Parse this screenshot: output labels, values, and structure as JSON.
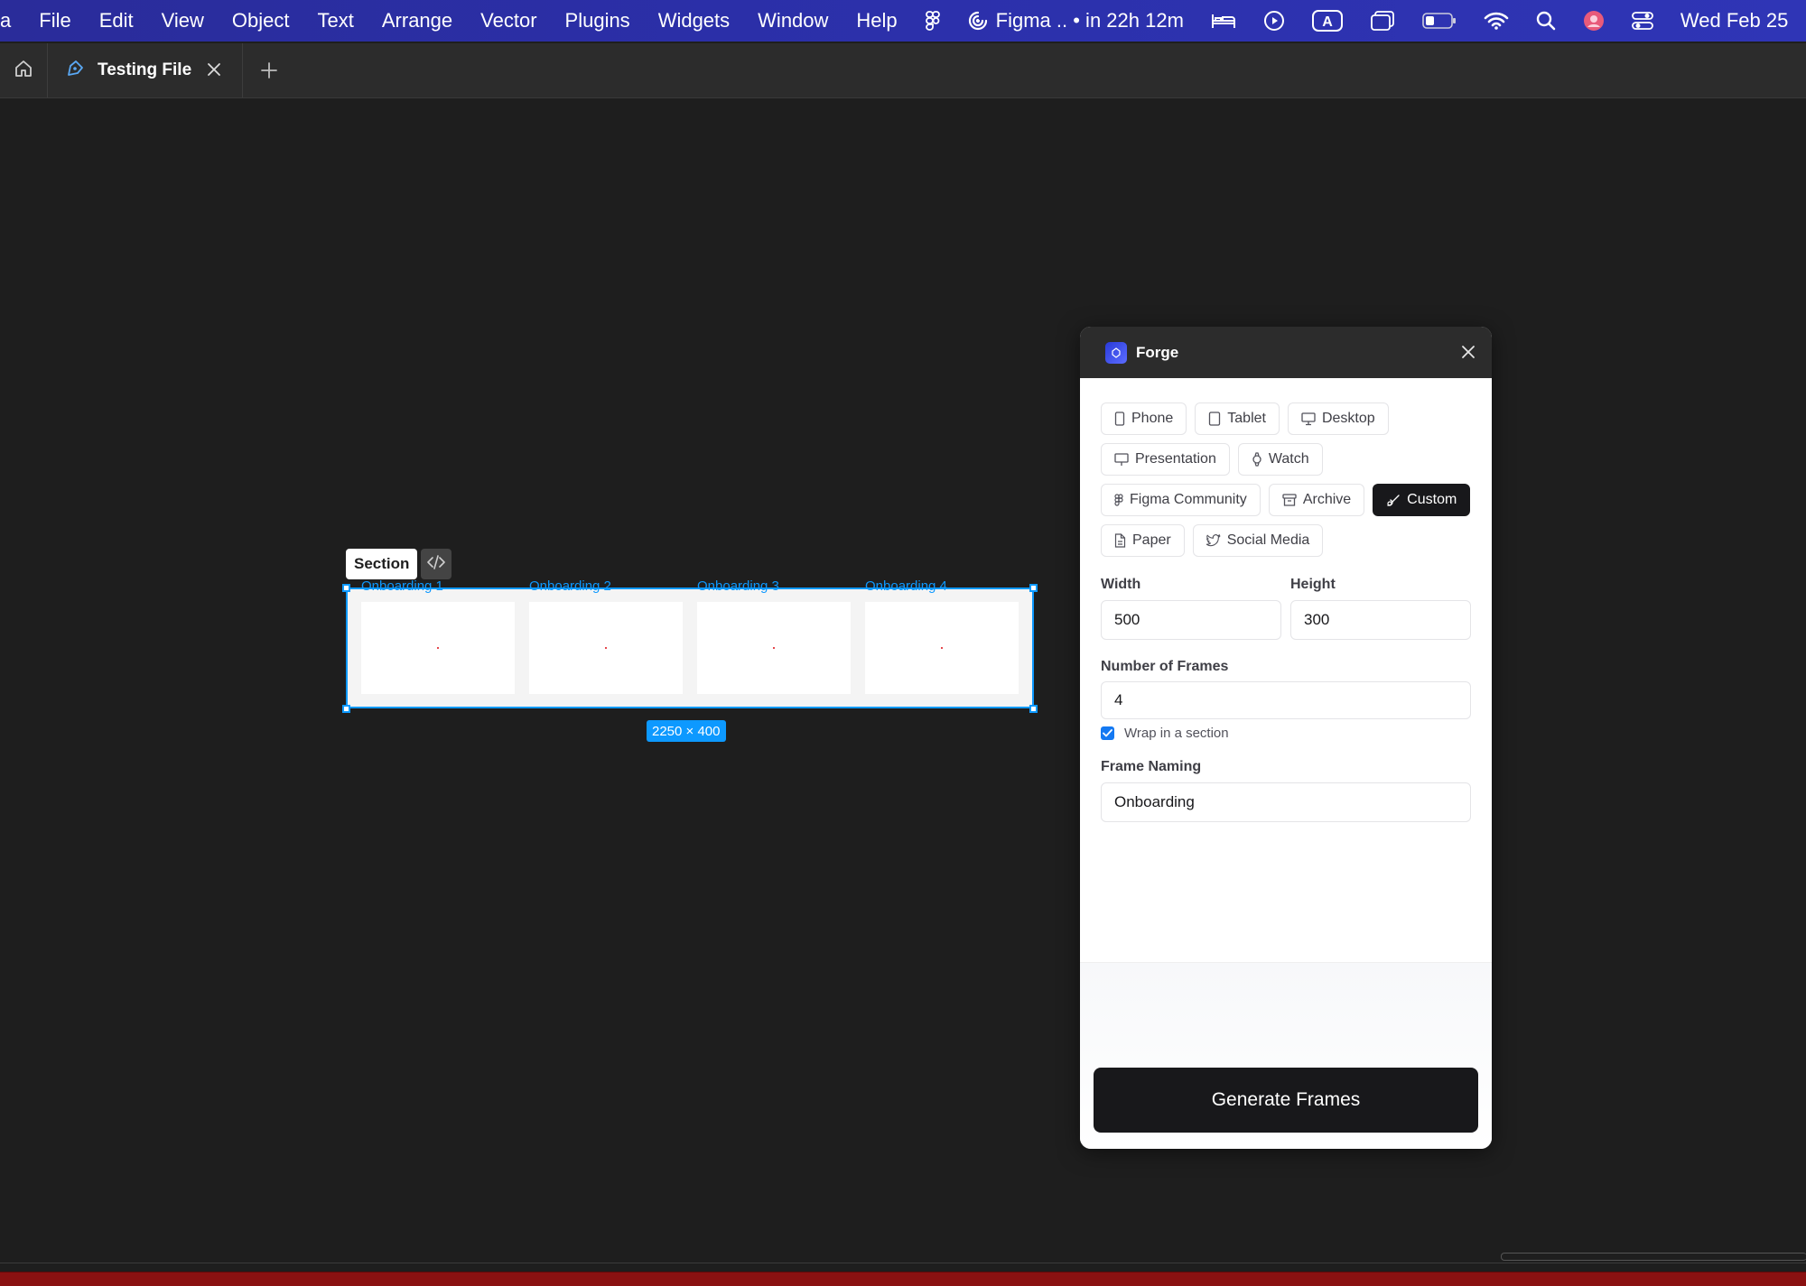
{
  "menubar": {
    "app_fragment": "a",
    "items": [
      "File",
      "Edit",
      "View",
      "Object",
      "Text",
      "Arrange",
      "Vector",
      "Plugins",
      "Widgets",
      "Window",
      "Help"
    ],
    "timer_text": "Figma .. • in 22h 12m",
    "clock_text": "Wed Feb 25"
  },
  "tabs": {
    "active_label": "Testing File"
  },
  "canvas": {
    "section_label": "Section",
    "frames": [
      "Onboarding 1",
      "Onboarding 2",
      "Onboarding 3",
      "Onboarding 4"
    ],
    "size_badge": "2250 × 400"
  },
  "plugin": {
    "title": "Forge",
    "presets": [
      [
        "Phone",
        "Tablet",
        "Desktop"
      ],
      [
        "Presentation",
        "Watch"
      ],
      [
        "Figma Community",
        "Archive",
        "Custom"
      ],
      [
        "Paper",
        "Social Media"
      ]
    ],
    "active_preset": "Custom",
    "width_label": "Width",
    "width_value": "500",
    "height_label": "Height",
    "height_value": "300",
    "frames_label": "Number of Frames",
    "frames_value": "4",
    "wrap_label": "Wrap in a section",
    "wrap_checked": true,
    "naming_label": "Frame Naming",
    "naming_value": "Onboarding",
    "generate_label": "Generate Frames"
  },
  "colors": {
    "selection": "#0d99ff",
    "menubar": "#2b2fa8",
    "canvas": "#1e1e1e",
    "primary_button": "#18181b"
  }
}
